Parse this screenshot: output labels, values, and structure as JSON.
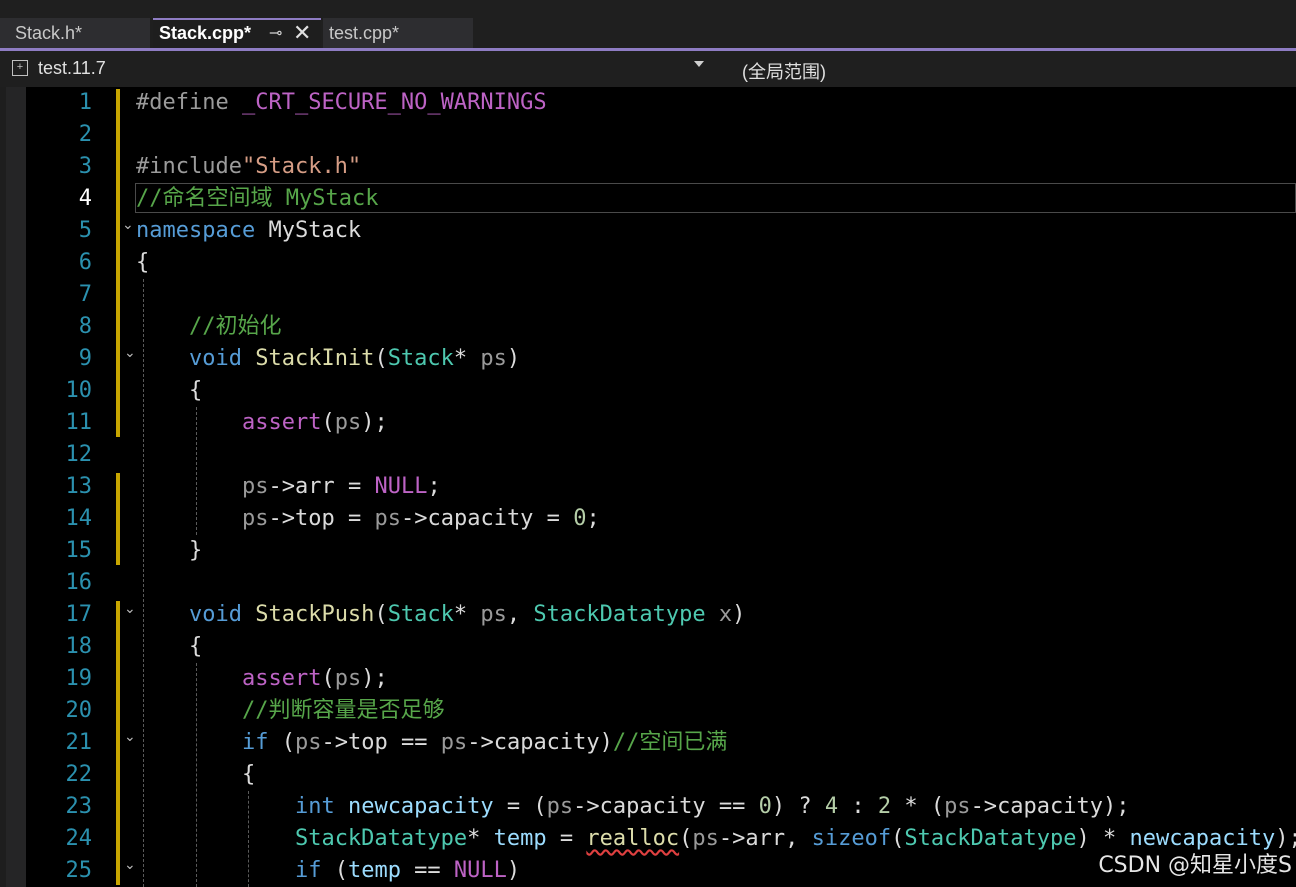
{
  "tabs": [
    {
      "label": "Stack.h*",
      "active": false
    },
    {
      "label": "Stack.cpp*",
      "active": true
    },
    {
      "label": "test.cpp*",
      "active": false
    }
  ],
  "tab_icons": {
    "pin": "pin-icon",
    "close": "close-icon"
  },
  "navbar": {
    "project": "test.11.7",
    "scope": "(全局范围)"
  },
  "colors": {
    "accent": "#8e7cc3",
    "keyword": "#569cd6",
    "type": "#4ec9b0",
    "function": "#dcdcaa",
    "comment": "#57a64a",
    "string": "#d69d85",
    "macro": "#bd63c5",
    "number": "#b5cea8",
    "member": "#dadada",
    "param": "#9a9a9a",
    "changed": "#c8a600"
  },
  "current_line": 4,
  "lines": [
    {
      "n": "1",
      "tokens": [
        {
          "t": "#define ",
          "c": "#9b9b9b"
        },
        {
          "t": "_CRT_SECURE_NO_WARNINGS",
          "c": "#bd63c5"
        }
      ]
    },
    {
      "n": "2",
      "tokens": []
    },
    {
      "n": "3",
      "tokens": [
        {
          "t": "#include",
          "c": "#9b9b9b"
        },
        {
          "t": "\"Stack.h\"",
          "c": "#d69d85"
        }
      ]
    },
    {
      "n": "4",
      "tokens": [
        {
          "t": "//命名空间域 MyStack",
          "c": "#57a64a"
        }
      ]
    },
    {
      "n": "5",
      "tokens": [
        {
          "t": "namespace",
          "c": "#569cd6"
        },
        {
          "t": " MyStack",
          "c": "#dcdcdc"
        }
      ]
    },
    {
      "n": "6",
      "tokens": [
        {
          "t": "{",
          "c": "#dcdcdc"
        }
      ]
    },
    {
      "n": "7",
      "tokens": []
    },
    {
      "n": "8",
      "tokens": [
        {
          "t": "    //初始化",
          "c": "#57a64a"
        }
      ]
    },
    {
      "n": "9",
      "tokens": [
        {
          "t": "    ",
          "c": "#dcdcdc"
        },
        {
          "t": "void",
          "c": "#569cd6"
        },
        {
          "t": " ",
          "c": "#dcdcdc"
        },
        {
          "t": "StackInit",
          "c": "#dcdcaa"
        },
        {
          "t": "(",
          "c": "#dcdcdc"
        },
        {
          "t": "Stack",
          "c": "#4ec9b0"
        },
        {
          "t": "* ",
          "c": "#dcdcdc"
        },
        {
          "t": "ps",
          "c": "#9a9a9a"
        },
        {
          "t": ")",
          "c": "#dcdcdc"
        }
      ]
    },
    {
      "n": "10",
      "tokens": [
        {
          "t": "    {",
          "c": "#dcdcdc"
        }
      ]
    },
    {
      "n": "11",
      "tokens": [
        {
          "t": "        ",
          "c": "#dcdcdc"
        },
        {
          "t": "assert",
          "c": "#bd63c5"
        },
        {
          "t": "(",
          "c": "#dcdcdc"
        },
        {
          "t": "ps",
          "c": "#9a9a9a"
        },
        {
          "t": ");",
          "c": "#dcdcdc"
        }
      ]
    },
    {
      "n": "12",
      "tokens": []
    },
    {
      "n": "13",
      "tokens": [
        {
          "t": "        ",
          "c": "#dcdcdc"
        },
        {
          "t": "ps",
          "c": "#9a9a9a"
        },
        {
          "t": "->",
          "c": "#dcdcdc"
        },
        {
          "t": "arr",
          "c": "#dadada"
        },
        {
          "t": " = ",
          "c": "#dcdcdc"
        },
        {
          "t": "NULL",
          "c": "#bd63c5"
        },
        {
          "t": ";",
          "c": "#dcdcdc"
        }
      ]
    },
    {
      "n": "14",
      "tokens": [
        {
          "t": "        ",
          "c": "#dcdcdc"
        },
        {
          "t": "ps",
          "c": "#9a9a9a"
        },
        {
          "t": "->",
          "c": "#dcdcdc"
        },
        {
          "t": "top",
          "c": "#dadada"
        },
        {
          "t": " = ",
          "c": "#dcdcdc"
        },
        {
          "t": "ps",
          "c": "#9a9a9a"
        },
        {
          "t": "->",
          "c": "#dcdcdc"
        },
        {
          "t": "capacity",
          "c": "#dadada"
        },
        {
          "t": " = ",
          "c": "#dcdcdc"
        },
        {
          "t": "0",
          "c": "#b5cea8"
        },
        {
          "t": ";",
          "c": "#dcdcdc"
        }
      ]
    },
    {
      "n": "15",
      "tokens": [
        {
          "t": "    }",
          "c": "#dcdcdc"
        }
      ]
    },
    {
      "n": "16",
      "tokens": []
    },
    {
      "n": "17",
      "tokens": [
        {
          "t": "    ",
          "c": "#dcdcdc"
        },
        {
          "t": "void",
          "c": "#569cd6"
        },
        {
          "t": " ",
          "c": "#dcdcdc"
        },
        {
          "t": "StackPush",
          "c": "#dcdcaa"
        },
        {
          "t": "(",
          "c": "#dcdcdc"
        },
        {
          "t": "Stack",
          "c": "#4ec9b0"
        },
        {
          "t": "* ",
          "c": "#dcdcdc"
        },
        {
          "t": "ps",
          "c": "#9a9a9a"
        },
        {
          "t": ", ",
          "c": "#dcdcdc"
        },
        {
          "t": "StackDatatype",
          "c": "#4ec9b0"
        },
        {
          "t": " ",
          "c": "#dcdcdc"
        },
        {
          "t": "x",
          "c": "#9a9a9a"
        },
        {
          "t": ")",
          "c": "#dcdcdc"
        }
      ]
    },
    {
      "n": "18",
      "tokens": [
        {
          "t": "    {",
          "c": "#dcdcdc"
        }
      ]
    },
    {
      "n": "19",
      "tokens": [
        {
          "t": "        ",
          "c": "#dcdcdc"
        },
        {
          "t": "assert",
          "c": "#bd63c5"
        },
        {
          "t": "(",
          "c": "#dcdcdc"
        },
        {
          "t": "ps",
          "c": "#9a9a9a"
        },
        {
          "t": ");",
          "c": "#dcdcdc"
        }
      ]
    },
    {
      "n": "20",
      "tokens": [
        {
          "t": "        //判断容量是否足够",
          "c": "#57a64a"
        }
      ]
    },
    {
      "n": "21",
      "tokens": [
        {
          "t": "        ",
          "c": "#dcdcdc"
        },
        {
          "t": "if",
          "c": "#569cd6"
        },
        {
          "t": " (",
          "c": "#dcdcdc"
        },
        {
          "t": "ps",
          "c": "#9a9a9a"
        },
        {
          "t": "->",
          "c": "#dcdcdc"
        },
        {
          "t": "top",
          "c": "#dadada"
        },
        {
          "t": " == ",
          "c": "#dcdcdc"
        },
        {
          "t": "ps",
          "c": "#9a9a9a"
        },
        {
          "t": "->",
          "c": "#dcdcdc"
        },
        {
          "t": "capacity",
          "c": "#dadada"
        },
        {
          "t": ")",
          "c": "#dcdcdc"
        },
        {
          "t": "//空间已满",
          "c": "#57a64a"
        }
      ]
    },
    {
      "n": "22",
      "tokens": [
        {
          "t": "        {",
          "c": "#dcdcdc"
        }
      ]
    },
    {
      "n": "23",
      "tokens": [
        {
          "t": "            ",
          "c": "#dcdcdc"
        },
        {
          "t": "int",
          "c": "#569cd6"
        },
        {
          "t": " ",
          "c": "#dcdcdc"
        },
        {
          "t": "newcapacity",
          "c": "#9cdcfe"
        },
        {
          "t": " = (",
          "c": "#dcdcdc"
        },
        {
          "t": "ps",
          "c": "#9a9a9a"
        },
        {
          "t": "->",
          "c": "#dcdcdc"
        },
        {
          "t": "capacity",
          "c": "#dadada"
        },
        {
          "t": " == ",
          "c": "#dcdcdc"
        },
        {
          "t": "0",
          "c": "#b5cea8"
        },
        {
          "t": ") ? ",
          "c": "#dcdcdc"
        },
        {
          "t": "4",
          "c": "#b5cea8"
        },
        {
          "t": " : ",
          "c": "#dcdcdc"
        },
        {
          "t": "2",
          "c": "#b5cea8"
        },
        {
          "t": " * (",
          "c": "#dcdcdc"
        },
        {
          "t": "ps",
          "c": "#9a9a9a"
        },
        {
          "t": "->",
          "c": "#dcdcdc"
        },
        {
          "t": "capacity",
          "c": "#dadada"
        },
        {
          "t": ");",
          "c": "#dcdcdc"
        }
      ]
    },
    {
      "n": "24",
      "tokens": [
        {
          "t": "            ",
          "c": "#dcdcdc"
        },
        {
          "t": "StackDatatype",
          "c": "#4ec9b0"
        },
        {
          "t": "* ",
          "c": "#dcdcdc"
        },
        {
          "t": "temp",
          "c": "#9cdcfe"
        },
        {
          "t": " = ",
          "c": "#dcdcdc"
        },
        {
          "t": "realloc",
          "c": "#dcdcaa",
          "squiggle": true
        },
        {
          "t": "(",
          "c": "#dcdcdc"
        },
        {
          "t": "ps",
          "c": "#9a9a9a"
        },
        {
          "t": "->",
          "c": "#dcdcdc"
        },
        {
          "t": "arr",
          "c": "#dadada"
        },
        {
          "t": ", ",
          "c": "#dcdcdc"
        },
        {
          "t": "sizeof",
          "c": "#569cd6"
        },
        {
          "t": "(",
          "c": "#dcdcdc"
        },
        {
          "t": "StackDatatype",
          "c": "#4ec9b0"
        },
        {
          "t": ") * ",
          "c": "#dcdcdc"
        },
        {
          "t": "newcapacity",
          "c": "#9cdcfe"
        },
        {
          "t": ");",
          "c": "#dcdcdc"
        }
      ]
    },
    {
      "n": "25",
      "tokens": [
        {
          "t": "            ",
          "c": "#dcdcdc"
        },
        {
          "t": "if",
          "c": "#569cd6"
        },
        {
          "t": " (",
          "c": "#dcdcdc"
        },
        {
          "t": "temp",
          "c": "#9cdcfe"
        },
        {
          "t": " == ",
          "c": "#dcdcdc"
        },
        {
          "t": "NULL",
          "c": "#bd63c5"
        },
        {
          "t": ")",
          "c": "#dcdcdc"
        }
      ]
    }
  ],
  "fold_lines": [
    5,
    9,
    17,
    21,
    25
  ],
  "changed_ranges": [
    [
      1,
      11
    ],
    [
      13,
      15
    ],
    [
      17,
      25
    ]
  ],
  "watermark": "CSDN @知星小度S"
}
